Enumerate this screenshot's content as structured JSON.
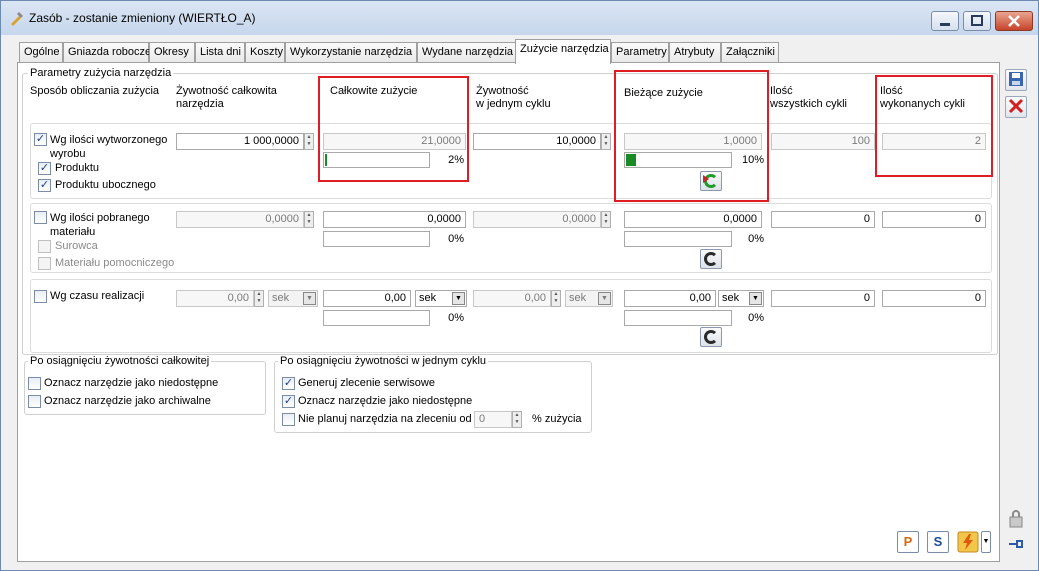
{
  "window": {
    "title": "Zasób - zostanie zmieniony  (WIERTŁO_A)"
  },
  "tabs": [
    {
      "label": "Ogólne"
    },
    {
      "label": "Gniazda robocze"
    },
    {
      "label": "Okresy"
    },
    {
      "label": "Lista dni"
    },
    {
      "label": "Koszty"
    },
    {
      "label": "Wykorzystanie narzędzia"
    },
    {
      "label": "Wydane narzędzia"
    },
    {
      "label": "Zużycie narzędzia"
    },
    {
      "label": "Parametry"
    },
    {
      "label": "Atrybuty"
    },
    {
      "label": "Załączniki"
    }
  ],
  "active_tab": "Zużycie narzędzia",
  "params": {
    "group_title": "Parametry zużycia narzędzia",
    "headers": {
      "method": "Sposób obliczania zużycia",
      "total_life": "Żywotność całkowita\nnarzędzia",
      "total_wear": "Całkowite zużycie",
      "cycle_life": "Żywotność\nw jednym cyklu",
      "current_wear": "Bieżące zużycie",
      "all_cycles": "Ilość\nwszystkich cykli",
      "done_cycles": "Ilość\nwykonanych cykli"
    },
    "row1": {
      "checkbox_label": "Wg ilości wytworzonego\nwyrobu",
      "checked": true,
      "sub1": "Produktu",
      "sub1_checked": true,
      "sub2": "Produktu ubocznego",
      "sub2_checked": true,
      "total_life": "1 000,0000",
      "total_wear": "21,0000",
      "total_wear_pct": "2%",
      "total_wear_progress": 0.02,
      "cycle_life": "10,0000",
      "current_wear": "1,0000",
      "current_wear_pct": "10%",
      "current_wear_progress": 0.1,
      "all_cycles": "100",
      "done_cycles": "2"
    },
    "row2": {
      "checkbox_label": "Wg ilości pobranego\nmateriału",
      "checked": false,
      "sub1": "Surowca",
      "sub1_checked": false,
      "sub2": "Materiału pomocniczego",
      "sub2_checked": false,
      "total_life": "0,0000",
      "total_wear": "0,0000",
      "total_wear_pct": "0%",
      "cycle_life": "0,0000",
      "current_wear": "0,0000",
      "current_wear_pct": "0%",
      "all_cycles": "0",
      "done_cycles": "0"
    },
    "row3": {
      "checkbox_label": "Wg czasu realizacji",
      "checked": false,
      "total_life": "0,00",
      "total_life_unit": "sek",
      "total_wear": "0,00",
      "total_wear_unit": "sek",
      "total_wear_pct": "0%",
      "cycle_life": "0,00",
      "cycle_life_unit": "sek",
      "current_wear": "0,00",
      "current_wear_unit": "sek",
      "current_wear_pct": "0%",
      "all_cycles": "0",
      "done_cycles": "0"
    }
  },
  "after_total": {
    "title": "Po osiągnięciu żywotności całkowitej",
    "opt1": "Oznacz narzędzie jako niedostępne",
    "opt1_checked": false,
    "opt2": "Oznacz narzędzie jako archiwalne",
    "opt2_checked": false
  },
  "after_cycle": {
    "title": "Po osiągnięciu żywotności w jednym cyklu",
    "opt1": "Generuj zlecenie serwisowe",
    "opt1_checked": true,
    "opt2": "Oznacz narzędzie jako niedostępne",
    "opt2_checked": true,
    "opt3": "Nie planuj narzędzia na zleceniu od",
    "opt3_checked": false,
    "opt3_value": "0",
    "opt3_suffix": "% zużycia"
  },
  "bottom_buttons": {
    "p_label": "P",
    "s_label": "S"
  },
  "colors": {
    "highlight": "#e01c24",
    "progress": "#1a8a24"
  }
}
